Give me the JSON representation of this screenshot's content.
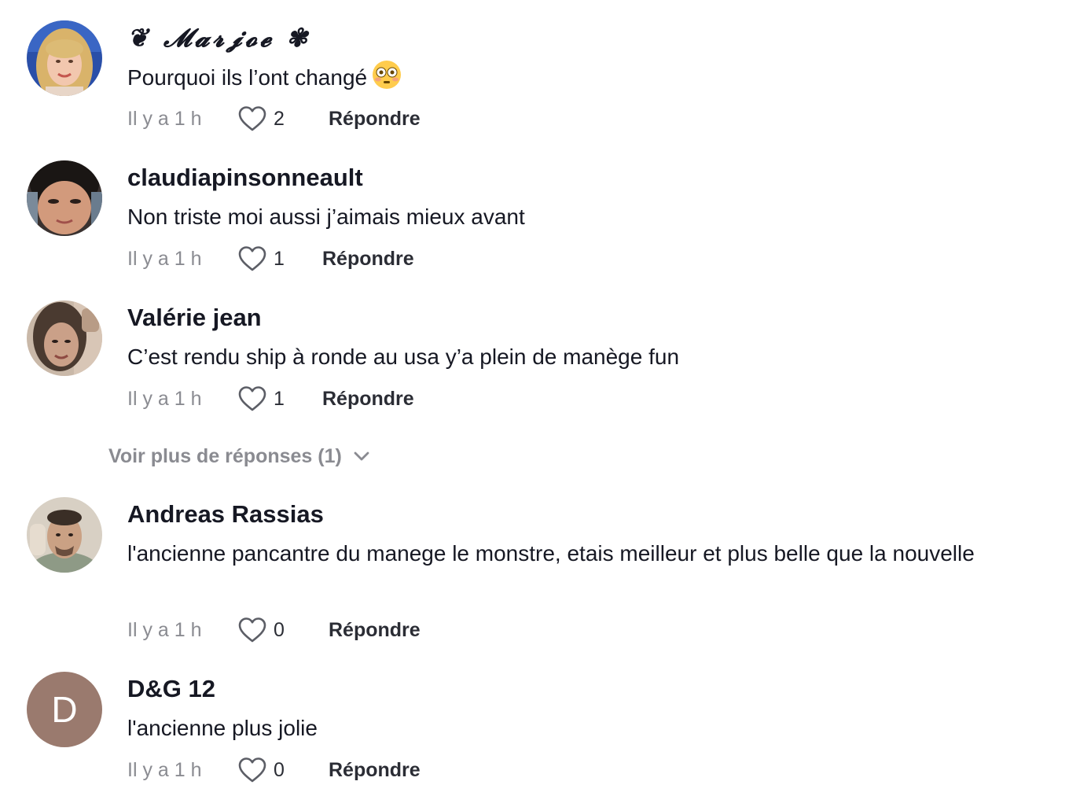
{
  "comments": [
    {
      "username": "❦ 𝓜𝓪𝓻𝓳𝓸𝓮 ✾",
      "text": "Pourquoi ils l’ont changé",
      "emoji": "flushed-face-emoji",
      "time": "Il y a 1 h",
      "likes": "2",
      "reply_label": "Répondre",
      "avatar": "photo-blonde-woman"
    },
    {
      "username": "claudiapinsonneault",
      "text": "Non triste moi aussi j’aimais mieux avant",
      "time": "Il y a 1 h",
      "likes": "1",
      "reply_label": "Répondre",
      "avatar": "photo-dark-haired-woman"
    },
    {
      "username": "Valérie jean",
      "text": "C’est rendu ship à ronde au usa y’a plein de manège fun",
      "time": "Il y a 1 h",
      "likes": "1",
      "reply_label": "Répondre",
      "avatar": "photo-brunette-woman"
    },
    {
      "username": "Andreas Rassias",
      "text": "l'ancienne pancantre du manege le monstre, etais meilleur et plus belle que la nouvelle",
      "time": "Il y a 1 h",
      "likes": "0",
      "reply_label": "Répondre",
      "avatar": "photo-man"
    },
    {
      "username": "D&G 12",
      "text": "l'ancienne plus jolie",
      "time": "Il y a 1 h",
      "likes": "0",
      "reply_label": "Répondre",
      "avatar_initial": "D",
      "avatar_color": "#9a7a6e"
    }
  ],
  "more_replies": {
    "label": "Voir plus de réponses (1)",
    "icon": "chevron-down-icon"
  },
  "colors": {
    "text_primary": "#161823",
    "text_secondary": "#8a8b91",
    "action": "#2b2d35"
  }
}
